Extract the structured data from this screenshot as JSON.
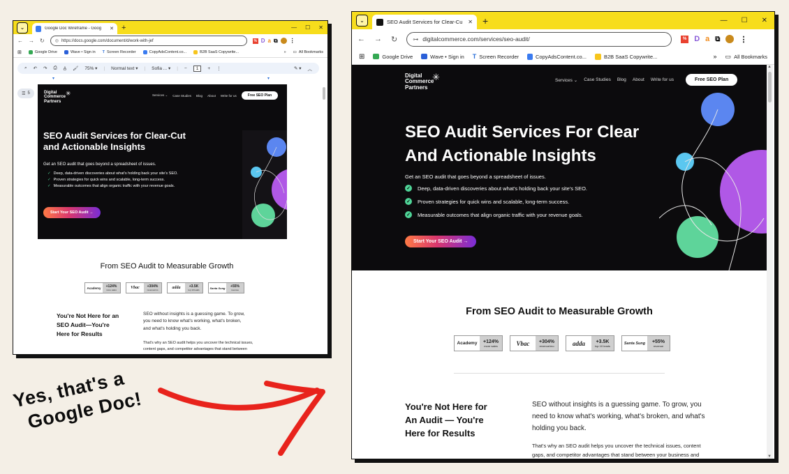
{
  "caption": {
    "line1": "Yes, that's a",
    "line2": "Google Doc!"
  },
  "left_window": {
    "tab_title": "Google Doc Wireframe - Goog",
    "url": "https://docs.google.com/document/d/work-with-jef",
    "bookmarks": [
      "Google Drive",
      "Wave • Sign in",
      "Screen Recorder",
      "CopyAdsContent.co...",
      "B2B SaaS Copywrite..."
    ],
    "all_bookmarks": "All Bookmarks",
    "docs_toolbar": {
      "zoom": "75%",
      "style": "Normal text",
      "font": "Sofia ...",
      "size": "1",
      "minus": "−",
      "plus": "+",
      "edit": "✎"
    },
    "outline_count": "5"
  },
  "right_window": {
    "tab_title": "SEO Audit Services for Clear-Cu",
    "url": "digitalcommerce.com/services/seo-audit/",
    "bookmarks": [
      "Google Drive",
      "Wave • Sign in",
      "Screen Recorder",
      "CopyAdsContent.co...",
      "B2B SaaS Copywrite..."
    ],
    "all_bookmarks": "All Bookmarks"
  },
  "site": {
    "logo": [
      "Digital",
      "Commerce",
      "Partners"
    ],
    "menu": [
      "Services ⌄",
      "Case Studies",
      "Blog",
      "About",
      "Write for us"
    ],
    "menu_cta": "Free SEO Plan",
    "hero_title_doc": [
      "SEO Audit Services for Clear-Cut",
      "and Actionable Insights"
    ],
    "hero_title_web": [
      "SEO Audit Services For Clear",
      "And Actionable Insights"
    ],
    "hero_sub": "Get an SEO audit that goes beyond a spreadsheet of issues.",
    "bullets": [
      "Deep, data-driven discoveries about what's holding back your site's SEO.",
      "Proven strategies for quick wins and scalable, long-term success.",
      "Measurable outcomes that align organic traffic with your revenue goals."
    ],
    "cta": "Start Your SEO Audit →",
    "growth_title": "From SEO Audit to Measurable Growth",
    "badges": [
      {
        "logo": "Academy",
        "value": "+124%",
        "sub": "more sales"
      },
      {
        "logo": "Vbac",
        "value": "+304%",
        "sub": "revenue/mo"
      },
      {
        "logo": "adda",
        "value": "+3.5K",
        "sub": "top 10 leads"
      },
      {
        "logo": "Santa Sung",
        "value": "+55%",
        "sub": "revenue"
      }
    ],
    "results_title_doc": [
      "You're Not Here for an",
      "SEO Audit—You're",
      "Here for Results"
    ],
    "results_title_web": [
      "You're Not Here for",
      "An Audit — You're",
      "Here for Results"
    ],
    "results_p1_doc": [
      "SEO without insights is a guessing game. To grow,",
      "you need to know what's working, what's broken,",
      "and what's holding you back."
    ],
    "results_p1_web": [
      "SEO without insights is a guessing game. To grow, you",
      "need to know what's working, what's broken, and what's",
      "holding you back."
    ],
    "results_p2_doc": [
      "That's why an SEO audit helps you uncover the technical issues,",
      "content gaps, and competitor advantages that stand between"
    ],
    "results_p2_web": [
      "That's why an SEO audit helps you uncover the technical issues, content",
      "gaps, and competitor advantages that stand between your business and"
    ]
  },
  "colors": {
    "chrome_yellow": "#f7dd1c",
    "hero_bg": "#0c0b0d",
    "check_green": "#4fd497",
    "arrow_red": "#e8231c"
  }
}
